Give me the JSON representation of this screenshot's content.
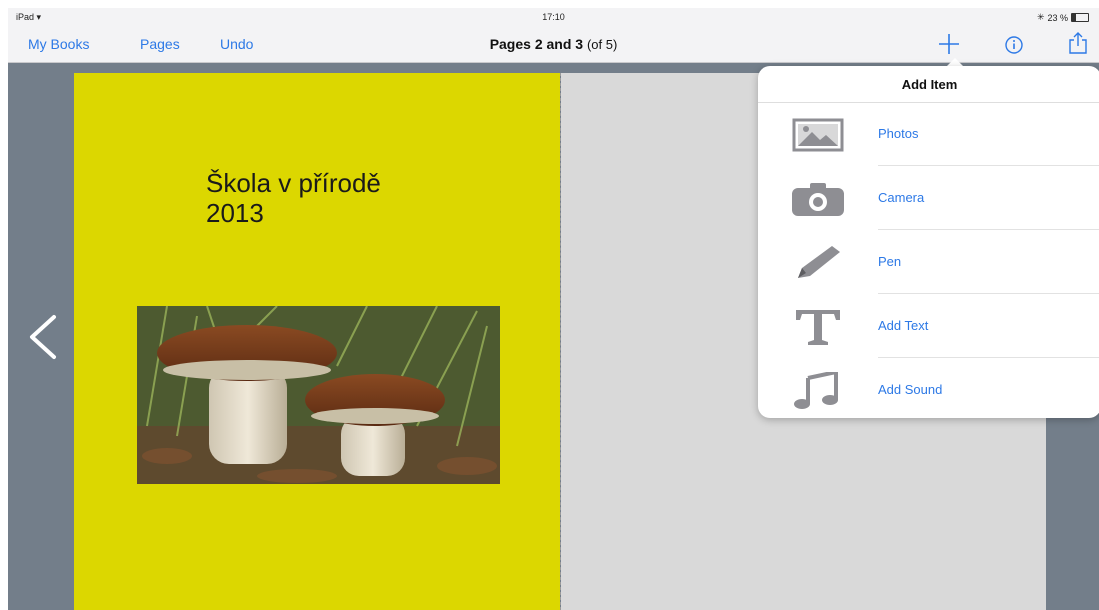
{
  "status_bar": {
    "device": "iPad",
    "time": "17:10",
    "battery": "23 %"
  },
  "nav": {
    "my_books": "My Books",
    "pages": "Pages",
    "undo": "Undo",
    "title": "Pages 2 and 3",
    "title_count": "(of 5)"
  },
  "book": {
    "left_page_title_line1": "Škola v přírodě",
    "left_page_title_line2": "2013",
    "left_page_color": "#dcd700",
    "right_page_color": "#d9d9d9"
  },
  "popover": {
    "title": "Add Item",
    "items": [
      {
        "label": "Photos",
        "icon": "photo-icon"
      },
      {
        "label": "Camera",
        "icon": "camera-icon"
      },
      {
        "label": "Pen",
        "icon": "pen-icon"
      },
      {
        "label": "Add Text",
        "icon": "text-icon"
      },
      {
        "label": "Add Sound",
        "icon": "music-note-icon"
      }
    ]
  },
  "colors": {
    "accent": "#2d79e6",
    "background": "#737e8a"
  }
}
